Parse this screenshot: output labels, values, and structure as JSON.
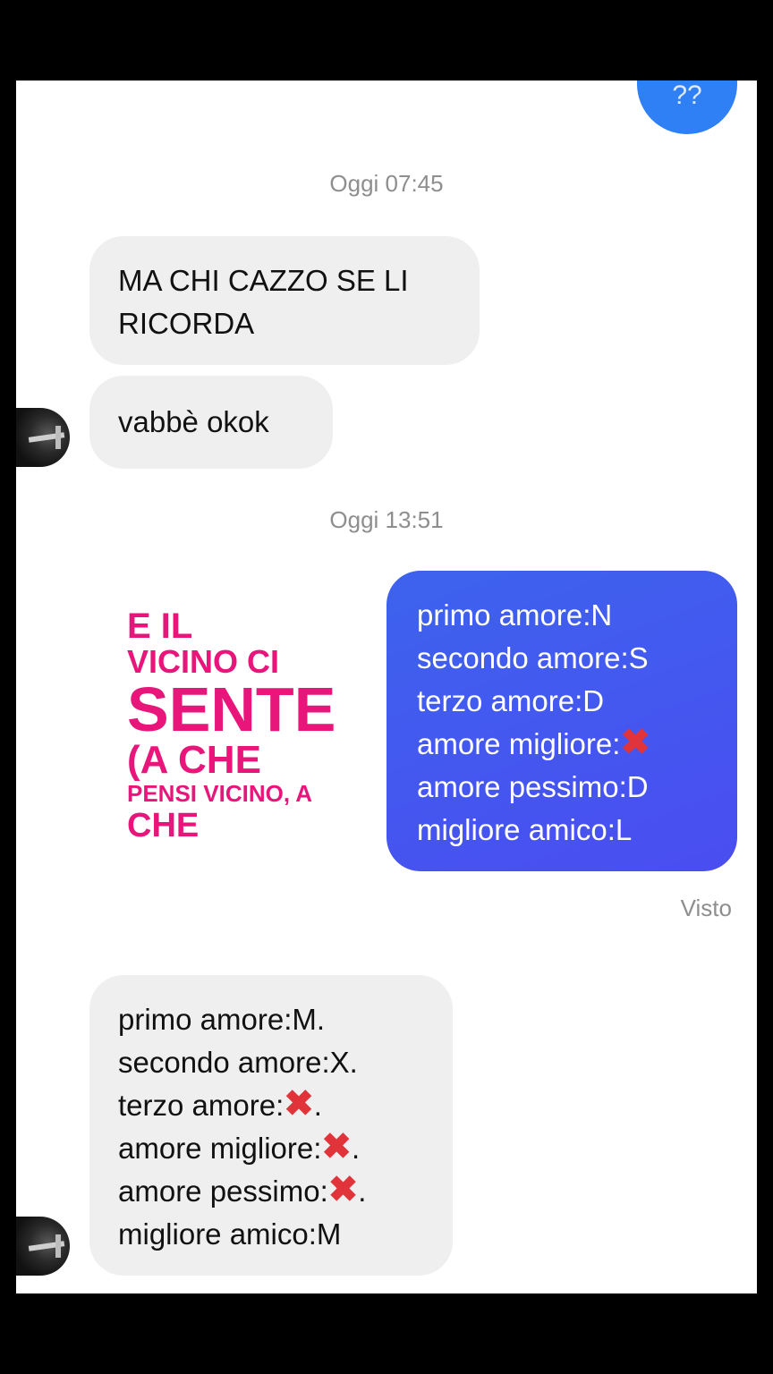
{
  "top_bubble": {
    "text": "??"
  },
  "timestamps": [
    "Oggi 07:45",
    "Oggi 13:51"
  ],
  "messages": {
    "m1": {
      "lines": [
        "MA CHI CAZZO SE LI",
        "RICORDA"
      ]
    },
    "m2": {
      "text": "vabbè okok"
    },
    "m3": {
      "lines": [
        {
          "text": "primo amore:N",
          "mark": ""
        },
        {
          "text": "secondo amore:S",
          "mark": ""
        },
        {
          "text": "terzo amore:D",
          "mark": ""
        },
        {
          "text": "amore migliore:",
          "mark": "✖"
        },
        {
          "text": "amore pessimo:D",
          "mark": ""
        },
        {
          "text": "migliore amico:L",
          "mark": ""
        }
      ]
    },
    "m4": {
      "lines": [
        {
          "text": "primo amore:M.",
          "mark": "",
          "suffix": ""
        },
        {
          "text": "secondo amore:X.",
          "mark": "",
          "suffix": ""
        },
        {
          "text": "terzo amore:",
          "mark": "✖",
          "suffix": "."
        },
        {
          "text": "amore migliore:",
          "mark": "✖",
          "suffix": "."
        },
        {
          "text": "amore pessimo:",
          "mark": "✖",
          "suffix": "."
        },
        {
          "text": "migliore amico:M",
          "mark": "",
          "suffix": ""
        }
      ]
    }
  },
  "status": {
    "seen": "Visto"
  },
  "overlay_caption": {
    "line1": "E IL",
    "line2": "VICINO CI",
    "line3": "SENTE",
    "line4": "(A CHE",
    "line5": "PENSI VICINO, A",
    "line6": "CHE"
  },
  "colors": {
    "incoming_bubble": "#efefef",
    "outgoing_bubble": "#4353f0",
    "caption": "#e8157a",
    "x_mark": "#e0343a"
  },
  "icons": {
    "x_mark": "cross-mark-icon",
    "avatar": "contact-avatar"
  }
}
